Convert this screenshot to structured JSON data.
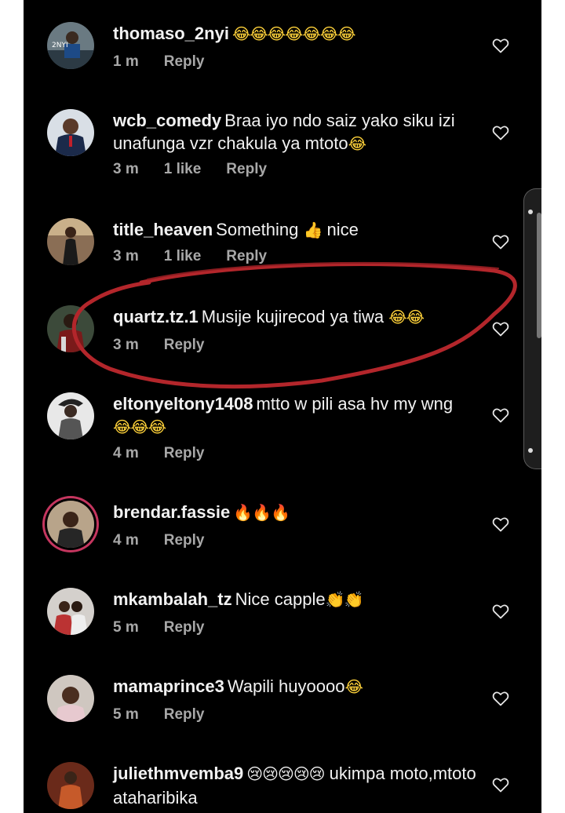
{
  "comments": [
    {
      "user": "thomaso_2nyi",
      "text": "",
      "emoji": "😂😂😂😂😂😂😂",
      "time": "1 m",
      "likes": "",
      "reply": "Reply"
    },
    {
      "user": "wcb_comedy",
      "text": "Braa iyo ndo saiz yako siku izi unafunga vzr chakula ya mtoto",
      "emoji": "😂",
      "time": "3 m",
      "likes": "1 like",
      "reply": "Reply"
    },
    {
      "user": "title_heaven",
      "text": "Something",
      "emoji_mid": "👍",
      "text2": "nice",
      "time": "3 m",
      "likes": "1 like",
      "reply": "Reply"
    },
    {
      "user": "quartz.tz.1",
      "text": "Musije kujirecod ya tiwa",
      "emoji": "😂😂",
      "time": "3 m",
      "likes": "",
      "reply": "Reply"
    },
    {
      "user": "eltonyeltony1408",
      "text": "mtto w pili asa hv my wng",
      "emoji": "😂😂😂",
      "time": "4 m",
      "likes": "",
      "reply": "Reply"
    },
    {
      "user": "brendar.fassie",
      "text": "",
      "emoji": "🔥🔥🔥",
      "time": "4 m",
      "likes": "",
      "reply": "Reply"
    },
    {
      "user": "mkambalah_tz",
      "text": "Nice capple",
      "emoji": "👏👏",
      "time": "5 m",
      "likes": "",
      "reply": "Reply"
    },
    {
      "user": "mamaprince3",
      "text": "Wapili huyoooo",
      "emoji": "😂",
      "time": "5 m",
      "likes": "",
      "reply": "Reply"
    },
    {
      "user": "juliethmvemba9",
      "emoji_pre": "😢😢😢😢😢",
      "text": "ukimpa moto,mtoto ataharibika",
      "time": "",
      "likes": "",
      "reply": ""
    }
  ],
  "icons": {
    "like": "heart-outline-icon"
  },
  "colors": {
    "background": "#000000",
    "username": "#f2f2f2",
    "meta": "#a8a8a8",
    "circle_annotation": "#b3262b",
    "story_ring": "#c5365f"
  }
}
